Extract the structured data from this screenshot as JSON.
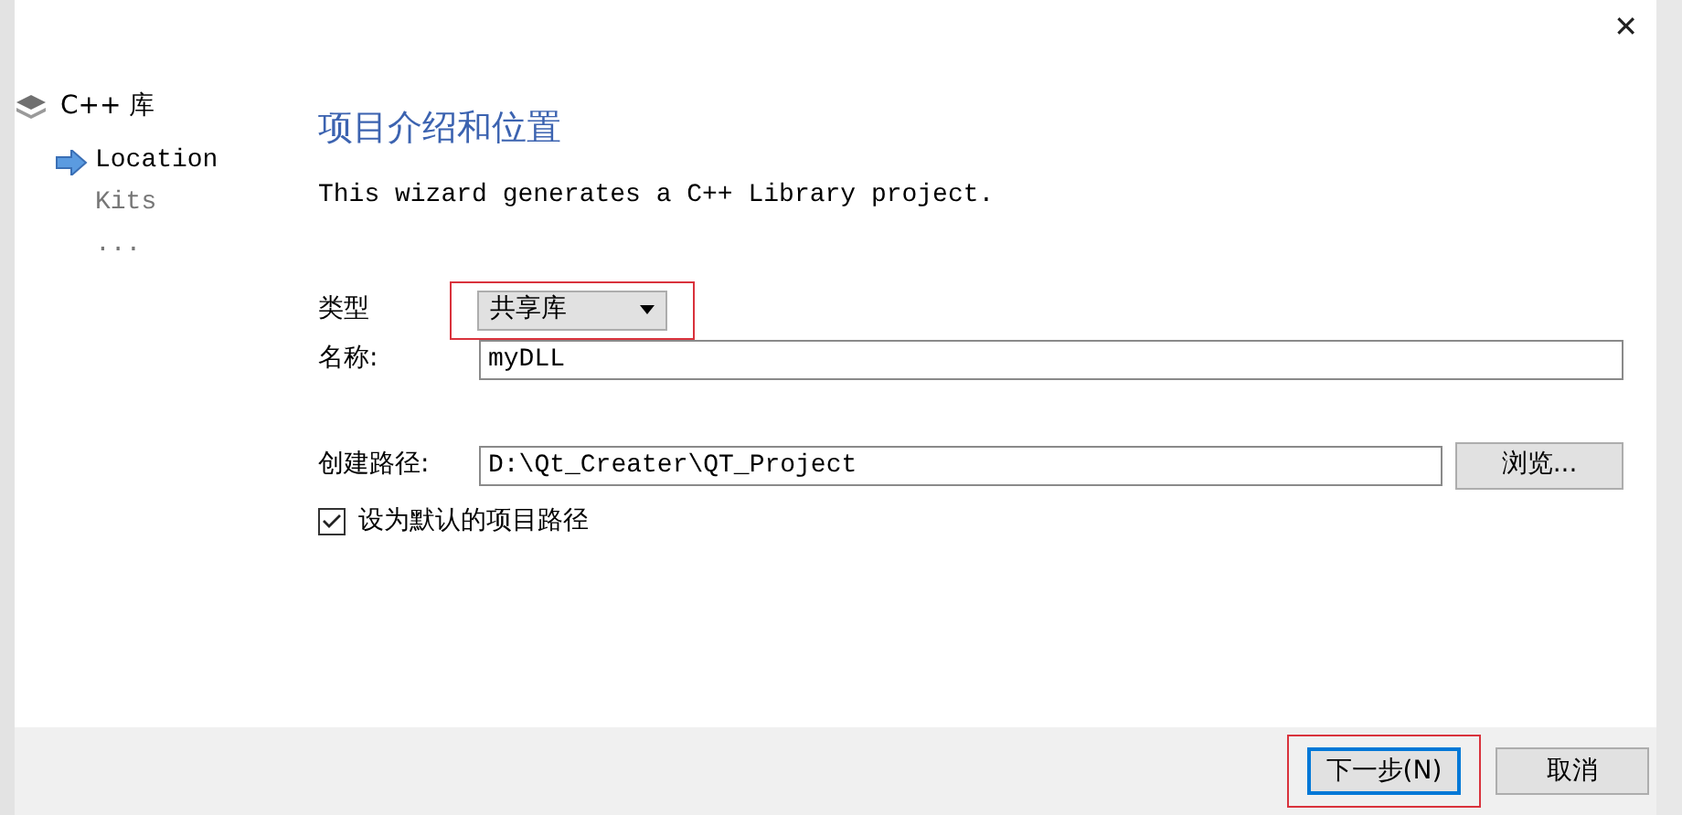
{
  "window": {
    "title": "C++ 库",
    "close": "✕"
  },
  "steps": [
    {
      "label": "Location",
      "selected": true
    },
    {
      "label": "Kits",
      "selected": false
    },
    {
      "label": "...",
      "selected": false
    }
  ],
  "page": {
    "heading": "项目介绍和位置",
    "description": "This wizard generates a C++ Library project."
  },
  "form": {
    "type_label": "类型",
    "type_value": "共享库",
    "type_highlighted": true,
    "name_label": "名称:",
    "name_value": "myDLL",
    "path_label": "创建路径:",
    "path_value": "D:\\Qt_Creater\\QT_Project",
    "browse": "浏览...",
    "default_label": "设为默认的项目路径",
    "default_checked": true
  },
  "buttons": [
    {
      "label": "下一步(N)",
      "kind": "primary",
      "highlighted": true
    },
    {
      "label": "取消",
      "kind": "normal",
      "highlighted": false
    }
  ]
}
